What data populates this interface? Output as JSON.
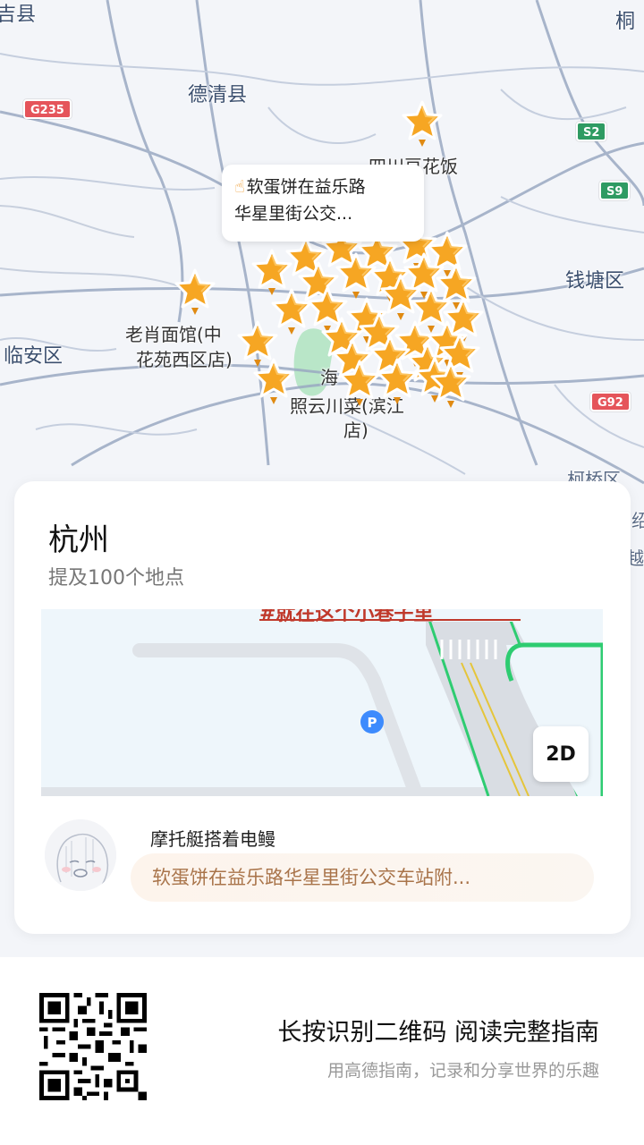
{
  "map": {
    "labels": {
      "anji": "吉县",
      "deqing": "德清县",
      "tongxiang": "桐",
      "qiantang": "钱塘区",
      "linan": "临安区",
      "keqiao": "柯桥区",
      "edge1": "绍",
      "edge2": "越"
    },
    "shields": {
      "g235": "G235",
      "s2": "S2",
      "s9": "S9",
      "g92": "G92"
    },
    "pois": {
      "doufu": "四川豆花饭",
      "laoxiao_line1": "老肖面馆(中",
      "laoxiao_line2": "花苑西区店)",
      "zhaoyun_line1": "照云川菜(滨江",
      "zhaoyun_line2": "店)",
      "hai": "海"
    },
    "callout": {
      "line1": "软蛋饼在益乐路",
      "line2": "华星里街公交..."
    },
    "star_color": "#f6a623"
  },
  "card": {
    "city": "杭州",
    "count": "提及100个地点",
    "thumb": {
      "banner_text": "#就在这个小巷子里",
      "mode_button": "2D"
    },
    "author": "摩托艇搭着电鳗",
    "note": "软蛋饼在益乐路华星里街公交车站附..."
  },
  "footer": {
    "title": "长按识别二维码 阅读完整指南",
    "subtitle": "用高德指南，记录和分享世界的乐趣"
  }
}
